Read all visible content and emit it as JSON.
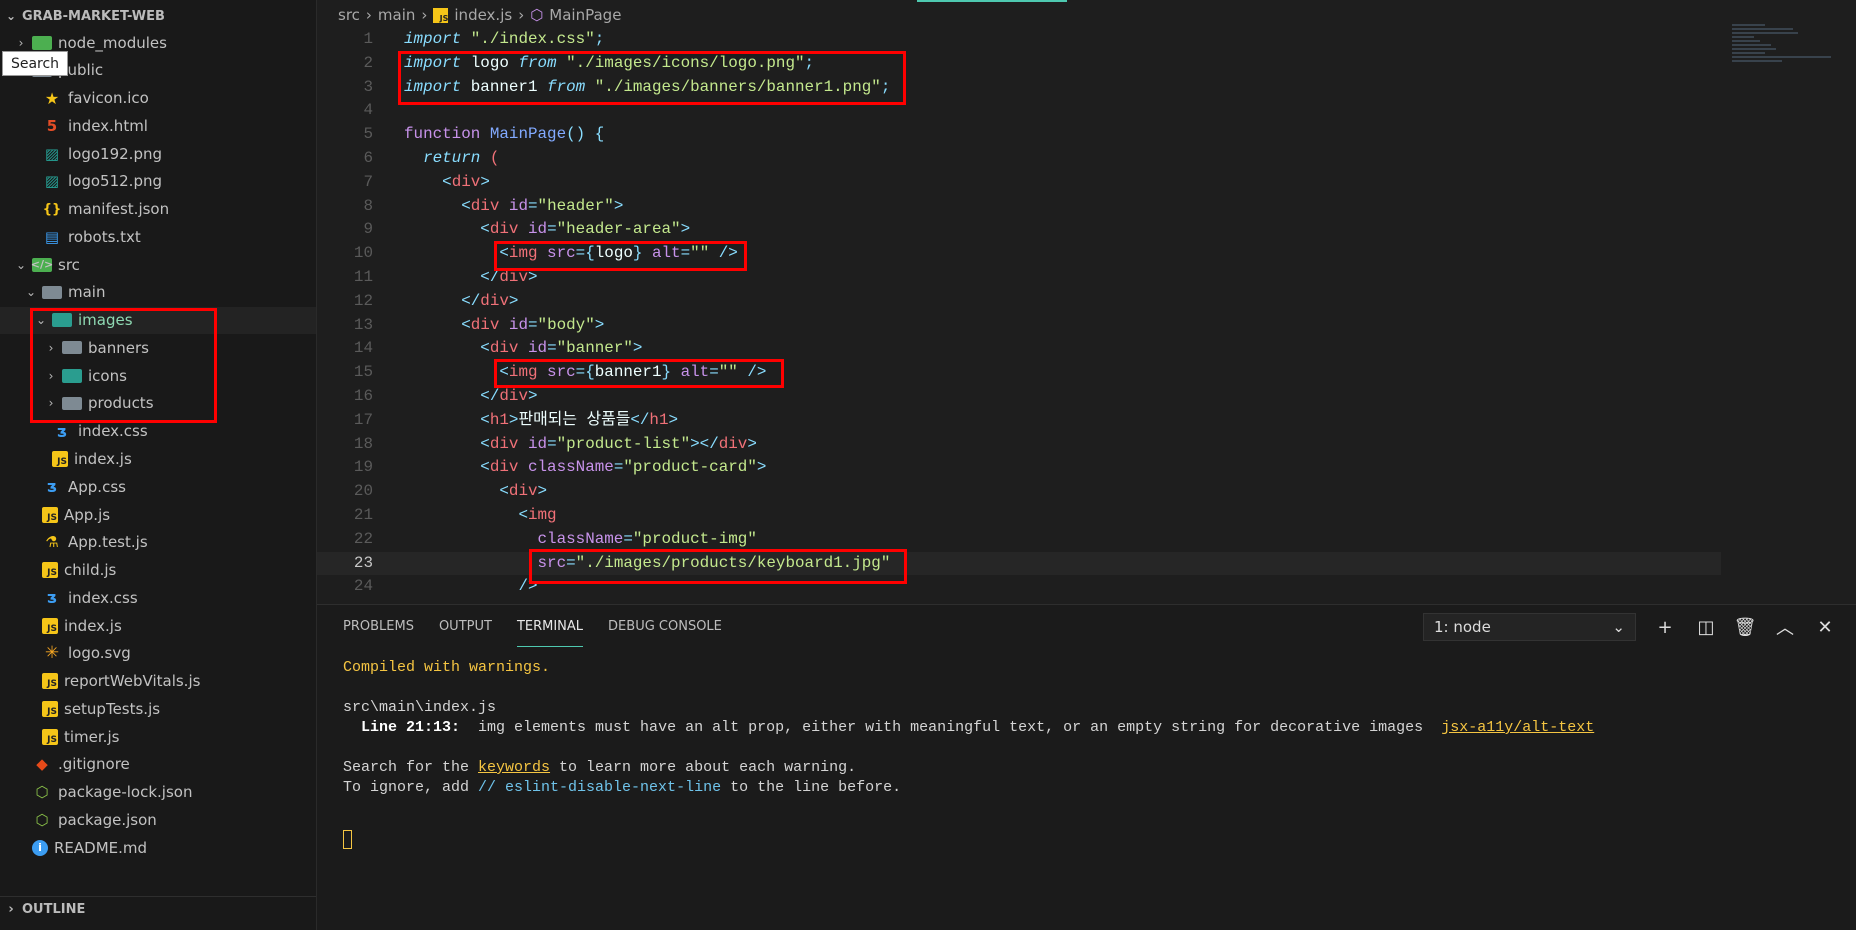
{
  "explorer": {
    "title": "GRAB-MARKET-WEB",
    "tooltip": "Search",
    "outline": "OUTLINE",
    "rows": [
      {
        "label": "node_modules",
        "depth": 0,
        "chev": "closed",
        "icon": "folder-node"
      },
      {
        "label": "public",
        "depth": 0,
        "chev": "open",
        "icon": "folder"
      },
      {
        "label": "favicon.ico",
        "depth": 1,
        "chev": "",
        "icon": "star"
      },
      {
        "label": "index.html",
        "depth": 1,
        "chev": "",
        "icon": "html"
      },
      {
        "label": "logo192.png",
        "depth": 1,
        "chev": "",
        "icon": "img"
      },
      {
        "label": "logo512.png",
        "depth": 1,
        "chev": "",
        "icon": "img"
      },
      {
        "label": "manifest.json",
        "depth": 1,
        "chev": "",
        "icon": "json"
      },
      {
        "label": "robots.txt",
        "depth": 1,
        "chev": "",
        "icon": "txt"
      },
      {
        "label": "src",
        "depth": 0,
        "chev": "open",
        "icon": "folder-src"
      },
      {
        "label": "main",
        "depth": 1,
        "chev": "open",
        "icon": "folder"
      },
      {
        "label": "images",
        "depth": 2,
        "chev": "open",
        "icon": "folder-img",
        "active": true
      },
      {
        "label": "banners",
        "depth": 3,
        "chev": "closed",
        "icon": "folder"
      },
      {
        "label": "icons",
        "depth": 3,
        "chev": "closed",
        "icon": "folder-img"
      },
      {
        "label": "products",
        "depth": 3,
        "chev": "closed",
        "icon": "folder"
      },
      {
        "label": "index.css",
        "depth": 2,
        "chev": "",
        "icon": "css"
      },
      {
        "label": "index.js",
        "depth": 2,
        "chev": "",
        "icon": "js"
      },
      {
        "label": "App.css",
        "depth": 1,
        "chev": "",
        "icon": "css"
      },
      {
        "label": "App.js",
        "depth": 1,
        "chev": "",
        "icon": "js"
      },
      {
        "label": "App.test.js",
        "depth": 1,
        "chev": "",
        "icon": "test"
      },
      {
        "label": "child.js",
        "depth": 1,
        "chev": "",
        "icon": "js"
      },
      {
        "label": "index.css",
        "depth": 1,
        "chev": "",
        "icon": "css"
      },
      {
        "label": "index.js",
        "depth": 1,
        "chev": "",
        "icon": "js"
      },
      {
        "label": "logo.svg",
        "depth": 1,
        "chev": "",
        "icon": "svg"
      },
      {
        "label": "reportWebVitals.js",
        "depth": 1,
        "chev": "",
        "icon": "js"
      },
      {
        "label": "setupTests.js",
        "depth": 1,
        "chev": "",
        "icon": "js"
      },
      {
        "label": "timer.js",
        "depth": 1,
        "chev": "",
        "icon": "js"
      },
      {
        "label": ".gitignore",
        "depth": 0,
        "chev": "",
        "icon": "git"
      },
      {
        "label": "package-lock.json",
        "depth": 0,
        "chev": "",
        "icon": "node"
      },
      {
        "label": "package.json",
        "depth": 0,
        "chev": "",
        "icon": "node"
      },
      {
        "label": "README.md",
        "depth": 0,
        "chev": "",
        "icon": "info"
      }
    ]
  },
  "breadcrumb": {
    "items": [
      "src",
      "main",
      "index.js",
      "MainPage"
    ]
  },
  "editor": {
    "current_line": 23,
    "lines": [
      [
        [
          "import",
          "kw"
        ],
        [
          " ",
          "plain"
        ],
        [
          "\"./index.css\"",
          "str"
        ],
        [
          ";",
          "pun"
        ]
      ],
      [
        [
          "import",
          "kw"
        ],
        [
          " logo ",
          "id"
        ],
        [
          "from",
          "kw"
        ],
        [
          " ",
          "plain"
        ],
        [
          "\"./images/icons/logo.png\"",
          "str"
        ],
        [
          ";",
          "pun"
        ]
      ],
      [
        [
          "import",
          "kw"
        ],
        [
          " banner1 ",
          "id"
        ],
        [
          "from",
          "kw"
        ],
        [
          " ",
          "plain"
        ],
        [
          "\"./images/banners/banner1.png\"",
          "str"
        ],
        [
          ";",
          "pun"
        ]
      ],
      [],
      [
        [
          "function",
          "fn"
        ],
        [
          " ",
          "plain"
        ],
        [
          "MainPage",
          "name"
        ],
        [
          "() {",
          "pun"
        ]
      ],
      [
        [
          "  ",
          "plain"
        ],
        [
          "return",
          "kw"
        ],
        [
          " (",
          "paren"
        ]
      ],
      [
        [
          "    ",
          "plain"
        ],
        [
          "<",
          "pun"
        ],
        [
          "div",
          "tag"
        ],
        [
          ">",
          "pun"
        ]
      ],
      [
        [
          "      ",
          "plain"
        ],
        [
          "<",
          "pun"
        ],
        [
          "div",
          "tag"
        ],
        [
          " id",
          "attr"
        ],
        [
          "=",
          "pun"
        ],
        [
          "\"header\"",
          "str"
        ],
        [
          ">",
          "pun"
        ]
      ],
      [
        [
          "        ",
          "plain"
        ],
        [
          "<",
          "pun"
        ],
        [
          "div",
          "tag"
        ],
        [
          " id",
          "attr"
        ],
        [
          "=",
          "pun"
        ],
        [
          "\"header-area\"",
          "str"
        ],
        [
          ">",
          "pun"
        ]
      ],
      [
        [
          "          ",
          "plain"
        ],
        [
          "<",
          "pun"
        ],
        [
          "img",
          "tag"
        ],
        [
          " src",
          "attr"
        ],
        [
          "={",
          "pun"
        ],
        [
          "logo",
          "id"
        ],
        [
          "}",
          "pun"
        ],
        [
          " alt",
          "attr"
        ],
        [
          "=",
          "pun"
        ],
        [
          "\"\"",
          "str"
        ],
        [
          " />",
          "pun"
        ]
      ],
      [
        [
          "        ",
          "plain"
        ],
        [
          "</",
          "pun"
        ],
        [
          "div",
          "tag"
        ],
        [
          ">",
          "pun"
        ]
      ],
      [
        [
          "      ",
          "plain"
        ],
        [
          "</",
          "pun"
        ],
        [
          "div",
          "tag"
        ],
        [
          ">",
          "pun"
        ]
      ],
      [
        [
          "      ",
          "plain"
        ],
        [
          "<",
          "pun"
        ],
        [
          "div",
          "tag"
        ],
        [
          " id",
          "attr"
        ],
        [
          "=",
          "pun"
        ],
        [
          "\"body\"",
          "str"
        ],
        [
          ">",
          "pun"
        ]
      ],
      [
        [
          "        ",
          "plain"
        ],
        [
          "<",
          "pun"
        ],
        [
          "div",
          "tag"
        ],
        [
          " id",
          "attr"
        ],
        [
          "=",
          "pun"
        ],
        [
          "\"banner\"",
          "str"
        ],
        [
          ">",
          "pun"
        ]
      ],
      [
        [
          "          ",
          "plain"
        ],
        [
          "<",
          "pun"
        ],
        [
          "img",
          "tag"
        ],
        [
          " src",
          "attr"
        ],
        [
          "={",
          "pun"
        ],
        [
          "banner1",
          "id"
        ],
        [
          "}",
          "pun"
        ],
        [
          " alt",
          "attr"
        ],
        [
          "=",
          "pun"
        ],
        [
          "\"\"",
          "str"
        ],
        [
          " />",
          "pun"
        ]
      ],
      [
        [
          "        ",
          "plain"
        ],
        [
          "</",
          "pun"
        ],
        [
          "div",
          "tag"
        ],
        [
          ">",
          "pun"
        ]
      ],
      [
        [
          "        ",
          "plain"
        ],
        [
          "<",
          "pun"
        ],
        [
          "h1",
          "tag"
        ],
        [
          ">",
          "pun"
        ],
        [
          "판매되는 상품들",
          "id"
        ],
        [
          "</",
          "pun"
        ],
        [
          "h1",
          "tag"
        ],
        [
          ">",
          "pun"
        ]
      ],
      [
        [
          "        ",
          "plain"
        ],
        [
          "<",
          "pun"
        ],
        [
          "div",
          "tag"
        ],
        [
          " id",
          "attr"
        ],
        [
          "=",
          "pun"
        ],
        [
          "\"product-list\"",
          "str"
        ],
        [
          "></",
          "pun"
        ],
        [
          "div",
          "tag"
        ],
        [
          ">",
          "pun"
        ]
      ],
      [
        [
          "        ",
          "plain"
        ],
        [
          "<",
          "pun"
        ],
        [
          "div",
          "tag"
        ],
        [
          " className",
          "attr"
        ],
        [
          "=",
          "pun"
        ],
        [
          "\"product-card\"",
          "str"
        ],
        [
          ">",
          "pun"
        ]
      ],
      [
        [
          "          ",
          "plain"
        ],
        [
          "<",
          "pun"
        ],
        [
          "div",
          "tag"
        ],
        [
          ">",
          "pun"
        ]
      ],
      [
        [
          "            ",
          "plain"
        ],
        [
          "<",
          "pun"
        ],
        [
          "img",
          "tag"
        ]
      ],
      [
        [
          "              ",
          "plain"
        ],
        [
          "className",
          "attr"
        ],
        [
          "=",
          "pun"
        ],
        [
          "\"product-img\"",
          "str"
        ]
      ],
      [
        [
          "              ",
          "plain"
        ],
        [
          "src",
          "attr"
        ],
        [
          "=",
          "pun"
        ],
        [
          "\"./images/products/keyboard1.jpg\"",
          "str"
        ]
      ],
      [
        [
          "            ",
          "plain"
        ],
        [
          "/>",
          "pun"
        ]
      ]
    ]
  },
  "panel": {
    "tabs": [
      "PROBLEMS",
      "OUTPUT",
      "TERMINAL",
      "DEBUG CONSOLE"
    ],
    "active_tab": "TERMINAL",
    "terminal_select": "1: node",
    "terminal": {
      "compiled": "Compiled with warnings.",
      "file": "src\\main\\index.js",
      "line_ref": "  Line 21:13:",
      "warning": "  img elements must have an alt prop, either with meaningful text, or an empty string for decorative images  ",
      "rule": "jsx-a11y/alt-text",
      "search_a": "Search for the ",
      "keywords": "keywords",
      "search_b": " to learn more about each warning.",
      "ignore_a": "To ignore, add ",
      "ignore_code": "// eslint-disable-next-line",
      "ignore_b": " to the line before."
    }
  }
}
